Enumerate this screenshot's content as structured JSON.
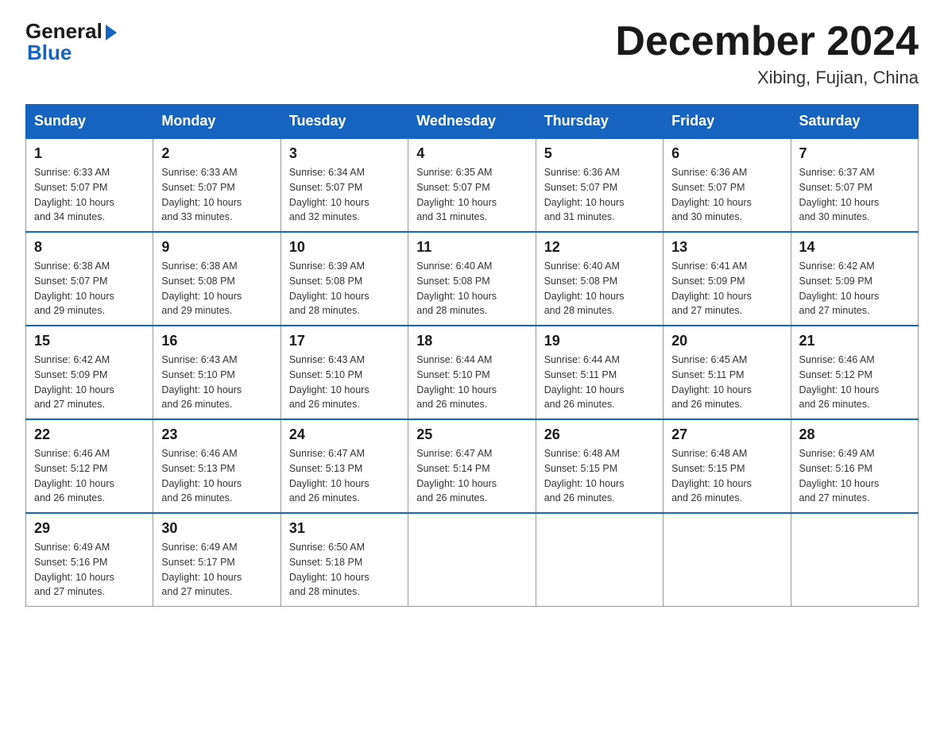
{
  "header": {
    "logo_general": "General",
    "logo_arrow": "▶",
    "logo_blue": "Blue",
    "month_title": "December 2024",
    "location": "Xibing, Fujian, China"
  },
  "weekdays": [
    "Sunday",
    "Monday",
    "Tuesday",
    "Wednesday",
    "Thursday",
    "Friday",
    "Saturday"
  ],
  "weeks": [
    [
      {
        "day": "1",
        "sunrise": "6:33 AM",
        "sunset": "5:07 PM",
        "daylight": "10 hours and 34 minutes."
      },
      {
        "day": "2",
        "sunrise": "6:33 AM",
        "sunset": "5:07 PM",
        "daylight": "10 hours and 33 minutes."
      },
      {
        "day": "3",
        "sunrise": "6:34 AM",
        "sunset": "5:07 PM",
        "daylight": "10 hours and 32 minutes."
      },
      {
        "day": "4",
        "sunrise": "6:35 AM",
        "sunset": "5:07 PM",
        "daylight": "10 hours and 31 minutes."
      },
      {
        "day": "5",
        "sunrise": "6:36 AM",
        "sunset": "5:07 PM",
        "daylight": "10 hours and 31 minutes."
      },
      {
        "day": "6",
        "sunrise": "6:36 AM",
        "sunset": "5:07 PM",
        "daylight": "10 hours and 30 minutes."
      },
      {
        "day": "7",
        "sunrise": "6:37 AM",
        "sunset": "5:07 PM",
        "daylight": "10 hours and 30 minutes."
      }
    ],
    [
      {
        "day": "8",
        "sunrise": "6:38 AM",
        "sunset": "5:07 PM",
        "daylight": "10 hours and 29 minutes."
      },
      {
        "day": "9",
        "sunrise": "6:38 AM",
        "sunset": "5:08 PM",
        "daylight": "10 hours and 29 minutes."
      },
      {
        "day": "10",
        "sunrise": "6:39 AM",
        "sunset": "5:08 PM",
        "daylight": "10 hours and 28 minutes."
      },
      {
        "day": "11",
        "sunrise": "6:40 AM",
        "sunset": "5:08 PM",
        "daylight": "10 hours and 28 minutes."
      },
      {
        "day": "12",
        "sunrise": "6:40 AM",
        "sunset": "5:08 PM",
        "daylight": "10 hours and 28 minutes."
      },
      {
        "day": "13",
        "sunrise": "6:41 AM",
        "sunset": "5:09 PM",
        "daylight": "10 hours and 27 minutes."
      },
      {
        "day": "14",
        "sunrise": "6:42 AM",
        "sunset": "5:09 PM",
        "daylight": "10 hours and 27 minutes."
      }
    ],
    [
      {
        "day": "15",
        "sunrise": "6:42 AM",
        "sunset": "5:09 PM",
        "daylight": "10 hours and 27 minutes."
      },
      {
        "day": "16",
        "sunrise": "6:43 AM",
        "sunset": "5:10 PM",
        "daylight": "10 hours and 26 minutes."
      },
      {
        "day": "17",
        "sunrise": "6:43 AM",
        "sunset": "5:10 PM",
        "daylight": "10 hours and 26 minutes."
      },
      {
        "day": "18",
        "sunrise": "6:44 AM",
        "sunset": "5:10 PM",
        "daylight": "10 hours and 26 minutes."
      },
      {
        "day": "19",
        "sunrise": "6:44 AM",
        "sunset": "5:11 PM",
        "daylight": "10 hours and 26 minutes."
      },
      {
        "day": "20",
        "sunrise": "6:45 AM",
        "sunset": "5:11 PM",
        "daylight": "10 hours and 26 minutes."
      },
      {
        "day": "21",
        "sunrise": "6:46 AM",
        "sunset": "5:12 PM",
        "daylight": "10 hours and 26 minutes."
      }
    ],
    [
      {
        "day": "22",
        "sunrise": "6:46 AM",
        "sunset": "5:12 PM",
        "daylight": "10 hours and 26 minutes."
      },
      {
        "day": "23",
        "sunrise": "6:46 AM",
        "sunset": "5:13 PM",
        "daylight": "10 hours and 26 minutes."
      },
      {
        "day": "24",
        "sunrise": "6:47 AM",
        "sunset": "5:13 PM",
        "daylight": "10 hours and 26 minutes."
      },
      {
        "day": "25",
        "sunrise": "6:47 AM",
        "sunset": "5:14 PM",
        "daylight": "10 hours and 26 minutes."
      },
      {
        "day": "26",
        "sunrise": "6:48 AM",
        "sunset": "5:15 PM",
        "daylight": "10 hours and 26 minutes."
      },
      {
        "day": "27",
        "sunrise": "6:48 AM",
        "sunset": "5:15 PM",
        "daylight": "10 hours and 26 minutes."
      },
      {
        "day": "28",
        "sunrise": "6:49 AM",
        "sunset": "5:16 PM",
        "daylight": "10 hours and 27 minutes."
      }
    ],
    [
      {
        "day": "29",
        "sunrise": "6:49 AM",
        "sunset": "5:16 PM",
        "daylight": "10 hours and 27 minutes."
      },
      {
        "day": "30",
        "sunrise": "6:49 AM",
        "sunset": "5:17 PM",
        "daylight": "10 hours and 27 minutes."
      },
      {
        "day": "31",
        "sunrise": "6:50 AM",
        "sunset": "5:18 PM",
        "daylight": "10 hours and 28 minutes."
      },
      null,
      null,
      null,
      null
    ]
  ],
  "labels": {
    "sunrise": "Sunrise:",
    "sunset": "Sunset:",
    "daylight": "Daylight:"
  }
}
